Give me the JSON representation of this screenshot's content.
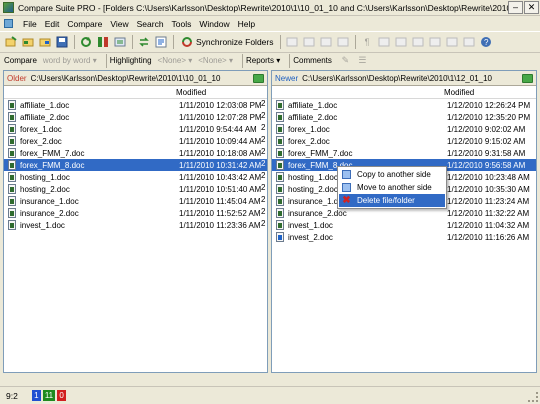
{
  "window": {
    "title": "Compare Suite PRO - [Folders C:\\Users\\Karlsson\\Desktop\\Rewrite\\2010\\1\\10_01_10 and C:\\Users\\Karlsson\\Desktop\\Rewrite\\2010\\1\\12_01_10]",
    "minimize": "–",
    "close": "✕"
  },
  "menu": [
    "File",
    "Edit",
    "Compare",
    "View",
    "Search",
    "Tools",
    "Window",
    "Help"
  ],
  "toolbar": {
    "sync_label": "Synchronize Folders"
  },
  "toolbar2": {
    "compare": "Compare",
    "word_by_word": "word by word ▾",
    "highlighting": "Highlighting",
    "none1": "<None> ▾",
    "none2": "<None> ▾",
    "reports": "Reports ▾",
    "comments": "Comments"
  },
  "left": {
    "label": "Older",
    "path": "C:\\Users\\Karlsson\\Desktop\\Rewrite\\2010\\1\\10_01_10",
    "modified_header": "Modified",
    "files": [
      {
        "name": "affiliate_1.doc",
        "mod": "1/11/2010 12:03:08 PM",
        "extra": "2"
      },
      {
        "name": "affiliate_2.doc",
        "mod": "1/11/2010 12:07:28 PM",
        "extra": "2"
      },
      {
        "name": "forex_1.doc",
        "mod": "1/11/2010 9:54:44 AM",
        "extra": "2"
      },
      {
        "name": "forex_2.doc",
        "mod": "1/11/2010 10:09:44 AM",
        "extra": "2"
      },
      {
        "name": "forex_FMM_7.doc",
        "mod": "1/11/2010 10:18:08 AM",
        "extra": "2"
      },
      {
        "name": "forex_FMM_8.doc",
        "mod": "1/11/2010 10:31:42 AM",
        "extra": "2",
        "selected": true
      },
      {
        "name": "hosting_1.doc",
        "mod": "1/11/2010 10:43:42 AM",
        "extra": "2"
      },
      {
        "name": "hosting_2.doc",
        "mod": "1/11/2010 10:51:40 AM",
        "extra": "2"
      },
      {
        "name": "insurance_1.doc",
        "mod": "1/11/2010 11:45:04 AM",
        "extra": "2"
      },
      {
        "name": "insurance_2.doc",
        "mod": "1/11/2010 11:52:52 AM",
        "extra": "2"
      },
      {
        "name": "invest_1.doc",
        "mod": "1/11/2010 11:23:36 AM",
        "extra": "2"
      }
    ]
  },
  "right": {
    "label": "Newer",
    "path": "C:\\Users\\Karlsson\\Desktop\\Rewrite\\2010\\1\\12_01_10",
    "modified_header": "Modified",
    "files": [
      {
        "name": "affiliate_1.doc",
        "mod": "1/12/2010 12:26:24 PM"
      },
      {
        "name": "affiliate_2.doc",
        "mod": "1/12/2010 12:35:20 PM"
      },
      {
        "name": "forex_1.doc",
        "mod": "1/12/2010 9:02:02 AM"
      },
      {
        "name": "forex_2.doc",
        "mod": "1/12/2010 9:15:02 AM"
      },
      {
        "name": "forex_FMM_7.doc",
        "mod": "1/12/2010 9:31:58 AM"
      },
      {
        "name": "forex_FMM_8.doc",
        "mod": "1/12/2010 9:56:58 AM",
        "selected": true
      },
      {
        "name": "hosting_1.doc",
        "mod": "1/12/2010 10:23:48 AM"
      },
      {
        "name": "hosting_2.doc",
        "mod": "1/12/2010 10:35:30 AM"
      },
      {
        "name": "insurance_1.doc",
        "mod": "1/12/2010 11:23:24 AM"
      },
      {
        "name": "insurance_2.doc",
        "mod": "1/12/2010 11:32:22 AM"
      },
      {
        "name": "invest_1.doc",
        "mod": "1/12/2010 11:04:32 AM"
      },
      {
        "name": "invest_2.doc",
        "mod": "1/12/2010 11:16:26 AM",
        "added": true
      }
    ]
  },
  "context_menu": {
    "items": [
      {
        "label": "Copy to another side",
        "icon": "copy-icon"
      },
      {
        "label": "Move to another side",
        "icon": "move-icon"
      },
      {
        "label": "Delete file/folder",
        "icon": "delete-icon",
        "active": true
      }
    ]
  },
  "status": {
    "ratio": "9:2",
    "badges": [
      {
        "value": "1",
        "color": "#1f4fd1"
      },
      {
        "value": "11",
        "color": "#1e8a1e"
      },
      {
        "value": "0",
        "color": "#d11f1f"
      }
    ]
  }
}
